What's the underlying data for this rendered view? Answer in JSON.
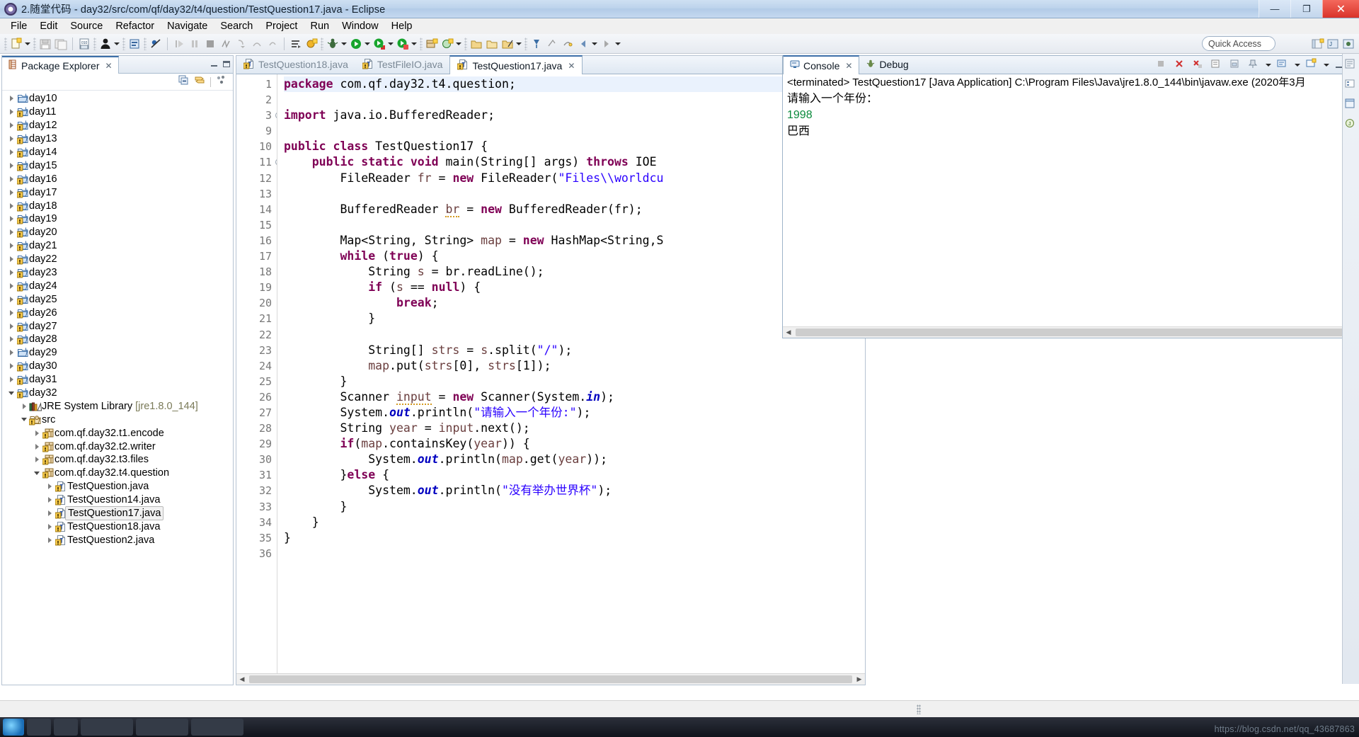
{
  "window": {
    "title": "2.随堂代码 - day32/src/com/qf/day32/t4/question/TestQuestion17.java - Eclipse",
    "minimize": "—",
    "maximize": "❐",
    "close": "✕"
  },
  "menubar": {
    "items": [
      "File",
      "Edit",
      "Source",
      "Refactor",
      "Navigate",
      "Search",
      "Project",
      "Run",
      "Window",
      "Help"
    ]
  },
  "toolbar": {
    "quick_access_placeholder": "Quick Access"
  },
  "package_explorer": {
    "tab_label": "Package Explorer",
    "close_label": "✕",
    "items": [
      {
        "label": "day10",
        "indent": 0,
        "icon": "folder-icon",
        "state": "closed",
        "warn": false
      },
      {
        "label": "day11",
        "indent": 0,
        "icon": "folder-icon",
        "state": "closed",
        "warn": true
      },
      {
        "label": "day12",
        "indent": 0,
        "icon": "folder-icon",
        "state": "closed",
        "warn": true
      },
      {
        "label": "day13",
        "indent": 0,
        "icon": "folder-icon",
        "state": "closed",
        "warn": true
      },
      {
        "label": "day14",
        "indent": 0,
        "icon": "folder-icon",
        "state": "closed",
        "warn": true
      },
      {
        "label": "day15",
        "indent": 0,
        "icon": "folder-icon",
        "state": "closed",
        "warn": true
      },
      {
        "label": "day16",
        "indent": 0,
        "icon": "folder-icon",
        "state": "closed",
        "warn": true
      },
      {
        "label": "day17",
        "indent": 0,
        "icon": "folder-icon",
        "state": "closed",
        "warn": true
      },
      {
        "label": "day18",
        "indent": 0,
        "icon": "folder-icon",
        "state": "closed",
        "warn": true
      },
      {
        "label": "day19",
        "indent": 0,
        "icon": "folder-icon",
        "state": "closed",
        "warn": true
      },
      {
        "label": "day20",
        "indent": 0,
        "icon": "folder-icon",
        "state": "closed",
        "warn": true
      },
      {
        "label": "day21",
        "indent": 0,
        "icon": "folder-icon",
        "state": "closed",
        "warn": true
      },
      {
        "label": "day22",
        "indent": 0,
        "icon": "folder-icon",
        "state": "closed",
        "warn": true
      },
      {
        "label": "day23",
        "indent": 0,
        "icon": "folder-icon",
        "state": "closed",
        "warn": true
      },
      {
        "label": "day24",
        "indent": 0,
        "icon": "folder-icon",
        "state": "closed",
        "warn": true
      },
      {
        "label": "day25",
        "indent": 0,
        "icon": "folder-icon",
        "state": "closed",
        "warn": true
      },
      {
        "label": "day26",
        "indent": 0,
        "icon": "folder-icon",
        "state": "closed",
        "warn": true
      },
      {
        "label": "day27",
        "indent": 0,
        "icon": "folder-icon",
        "state": "closed",
        "warn": true
      },
      {
        "label": "day28",
        "indent": 0,
        "icon": "folder-icon",
        "state": "closed",
        "warn": true
      },
      {
        "label": "day29",
        "indent": 0,
        "icon": "folder-icon",
        "state": "closed",
        "warn": false
      },
      {
        "label": "day30",
        "indent": 0,
        "icon": "folder-icon",
        "state": "closed",
        "warn": true
      },
      {
        "label": "day31",
        "indent": 0,
        "icon": "folder-icon",
        "state": "closed",
        "warn": true
      },
      {
        "label": "day32",
        "indent": 0,
        "icon": "folder-icon",
        "state": "open",
        "warn": true
      },
      {
        "label": "JRE System Library ",
        "suffix": "[jre1.8.0_144]",
        "indent": 1,
        "icon": "jre-library-icon",
        "state": "closed",
        "warn": false
      },
      {
        "label": "src",
        "indent": 1,
        "icon": "source-folder-icon",
        "state": "open",
        "warn": true
      },
      {
        "label": "com.qf.day32.t1.encode",
        "indent": 2,
        "icon": "package-icon",
        "state": "closed",
        "warn": true
      },
      {
        "label": "com.qf.day32.t2.writer",
        "indent": 2,
        "icon": "package-icon",
        "state": "closed",
        "warn": true
      },
      {
        "label": "com.qf.day32.t3.files",
        "indent": 2,
        "icon": "package-icon",
        "state": "closed",
        "warn": true
      },
      {
        "label": "com.qf.day32.t4.question",
        "indent": 2,
        "icon": "package-icon",
        "state": "open",
        "warn": true
      },
      {
        "label": "TestQuestion.java",
        "indent": 3,
        "icon": "java-file-icon",
        "state": "closed",
        "warn": true
      },
      {
        "label": "TestQuestion14.java",
        "indent": 3,
        "icon": "java-file-icon",
        "state": "closed",
        "warn": true
      },
      {
        "label": "TestQuestion17.java",
        "indent": 3,
        "icon": "java-file-icon",
        "state": "closed",
        "warn": true,
        "selected": true
      },
      {
        "label": "TestQuestion18.java",
        "indent": 3,
        "icon": "java-file-icon",
        "state": "closed",
        "warn": true
      },
      {
        "label": "TestQuestion2.java",
        "indent": 3,
        "icon": "java-file-icon",
        "state": "closed",
        "warn": true
      }
    ]
  },
  "editor": {
    "tabs": [
      {
        "label": "TestQuestion18.java",
        "active": false
      },
      {
        "label": "TestFileIO.java",
        "active": false
      },
      {
        "label": "TestQuestion17.java",
        "active": true,
        "close": "✕"
      }
    ],
    "line_numbers": [
      "1",
      "2",
      "3",
      "9",
      "10",
      "11",
      "12",
      "13",
      "14",
      "15",
      "16",
      "17",
      "18",
      "19",
      "20",
      "21",
      "22",
      "23",
      "24",
      "25",
      "26",
      "27",
      "28",
      "29",
      "30",
      "31",
      "32",
      "33",
      "34",
      "35",
      "36"
    ],
    "lines": [
      {
        "n": "1",
        "highlight": true,
        "fold": false,
        "annot": null,
        "tokens": [
          {
            "t": "package",
            "c": "kw"
          },
          {
            "t": " com.qf.day32.t4.question;",
            "c": ""
          }
        ]
      },
      {
        "n": "2",
        "highlight": false,
        "fold": false,
        "annot": null,
        "tokens": []
      },
      {
        "n": "3",
        "highlight": false,
        "fold": true,
        "annot": null,
        "tokens": [
          {
            "t": "import",
            "c": "kw"
          },
          {
            "t": " java.io.BufferedReader;",
            "c": ""
          }
        ]
      },
      {
        "n": "9",
        "highlight": false,
        "fold": false,
        "annot": null,
        "tokens": []
      },
      {
        "n": "10",
        "highlight": false,
        "fold": false,
        "annot": null,
        "tokens": [
          {
            "t": "public class",
            "c": "kw"
          },
          {
            "t": " TestQuestion17 {",
            "c": ""
          }
        ]
      },
      {
        "n": "11",
        "highlight": false,
        "fold": "minus",
        "annot": null,
        "tokens": [
          {
            "t": "    ",
            "c": ""
          },
          {
            "t": "public static void",
            "c": "kw"
          },
          {
            "t": " main(String[] args) ",
            "c": ""
          },
          {
            "t": "throws",
            "c": "kw"
          },
          {
            "t": " IOE",
            "c": ""
          }
        ]
      },
      {
        "n": "12",
        "highlight": false,
        "fold": false,
        "annot": null,
        "tokens": [
          {
            "t": "        FileReader ",
            "c": ""
          },
          {
            "t": "fr",
            "c": "loc"
          },
          {
            "t": " = ",
            "c": ""
          },
          {
            "t": "new",
            "c": "kw"
          },
          {
            "t": " FileReader(",
            "c": ""
          },
          {
            "t": "\"Files\\\\worldcu",
            "c": "str"
          }
        ]
      },
      {
        "n": "13",
        "highlight": false,
        "fold": false,
        "annot": null,
        "tokens": []
      },
      {
        "n": "14",
        "highlight": false,
        "fold": false,
        "annot": "warn",
        "tokens": [
          {
            "t": "        BufferedReader ",
            "c": ""
          },
          {
            "t": "br",
            "c": "loc und"
          },
          {
            "t": " = ",
            "c": ""
          },
          {
            "t": "new",
            "c": "kw"
          },
          {
            "t": " BufferedReader(fr);",
            "c": ""
          }
        ]
      },
      {
        "n": "15",
        "highlight": false,
        "fold": false,
        "annot": null,
        "tokens": []
      },
      {
        "n": "16",
        "highlight": false,
        "fold": false,
        "annot": null,
        "tokens": [
          {
            "t": "        Map<String, String> ",
            "c": ""
          },
          {
            "t": "map",
            "c": "loc"
          },
          {
            "t": " = ",
            "c": ""
          },
          {
            "t": "new",
            "c": "kw"
          },
          {
            "t": " HashMap<String,S",
            "c": ""
          }
        ]
      },
      {
        "n": "17",
        "highlight": false,
        "fold": false,
        "annot": null,
        "tokens": [
          {
            "t": "        ",
            "c": ""
          },
          {
            "t": "while",
            "c": "kw"
          },
          {
            "t": " (",
            "c": ""
          },
          {
            "t": "true",
            "c": "kw"
          },
          {
            "t": ") {",
            "c": ""
          }
        ]
      },
      {
        "n": "18",
        "highlight": false,
        "fold": false,
        "annot": null,
        "tokens": [
          {
            "t": "            String ",
            "c": ""
          },
          {
            "t": "s",
            "c": "loc"
          },
          {
            "t": " = br.readLine();",
            "c": ""
          }
        ]
      },
      {
        "n": "19",
        "highlight": false,
        "fold": false,
        "annot": null,
        "tokens": [
          {
            "t": "            ",
            "c": ""
          },
          {
            "t": "if",
            "c": "kw"
          },
          {
            "t": " (",
            "c": ""
          },
          {
            "t": "s",
            "c": "loc"
          },
          {
            "t": " == ",
            "c": ""
          },
          {
            "t": "null",
            "c": "kw"
          },
          {
            "t": ") {",
            "c": ""
          }
        ]
      },
      {
        "n": "20",
        "highlight": false,
        "fold": false,
        "annot": null,
        "tokens": [
          {
            "t": "                ",
            "c": ""
          },
          {
            "t": "break",
            "c": "kw"
          },
          {
            "t": ";",
            "c": ""
          }
        ]
      },
      {
        "n": "21",
        "highlight": false,
        "fold": false,
        "annot": null,
        "tokens": [
          {
            "t": "            }",
            "c": ""
          }
        ]
      },
      {
        "n": "22",
        "highlight": false,
        "fold": false,
        "annot": null,
        "tokens": []
      },
      {
        "n": "23",
        "highlight": false,
        "fold": false,
        "annot": null,
        "tokens": [
          {
            "t": "            String[] ",
            "c": ""
          },
          {
            "t": "strs",
            "c": "loc"
          },
          {
            "t": " = ",
            "c": ""
          },
          {
            "t": "s",
            "c": "loc"
          },
          {
            "t": ".split(",
            "c": ""
          },
          {
            "t": "\"/\"",
            "c": "str"
          },
          {
            "t": ");",
            "c": ""
          }
        ]
      },
      {
        "n": "24",
        "highlight": false,
        "fold": false,
        "annot": null,
        "tokens": [
          {
            "t": "            ",
            "c": ""
          },
          {
            "t": "map",
            "c": "loc"
          },
          {
            "t": ".put(",
            "c": ""
          },
          {
            "t": "strs",
            "c": "loc"
          },
          {
            "t": "[0], ",
            "c": ""
          },
          {
            "t": "strs",
            "c": "loc"
          },
          {
            "t": "[1]);",
            "c": ""
          }
        ]
      },
      {
        "n": "25",
        "highlight": false,
        "fold": false,
        "annot": null,
        "tokens": [
          {
            "t": "        }",
            "c": ""
          }
        ]
      },
      {
        "n": "26",
        "highlight": false,
        "fold": false,
        "annot": "warn",
        "tokens": [
          {
            "t": "        Scanner ",
            "c": ""
          },
          {
            "t": "input",
            "c": "loc und"
          },
          {
            "t": " = ",
            "c": ""
          },
          {
            "t": "new",
            "c": "kw"
          },
          {
            "t": " Scanner(System.",
            "c": ""
          },
          {
            "t": "in",
            "c": "fld"
          },
          {
            "t": ");",
            "c": ""
          }
        ]
      },
      {
        "n": "27",
        "highlight": false,
        "fold": false,
        "annot": null,
        "tokens": [
          {
            "t": "        System.",
            "c": ""
          },
          {
            "t": "out",
            "c": "fld"
          },
          {
            "t": ".println(",
            "c": ""
          },
          {
            "t": "\"请输入一个年份:\"",
            "c": "str"
          },
          {
            "t": ");",
            "c": ""
          }
        ]
      },
      {
        "n": "28",
        "highlight": false,
        "fold": false,
        "annot": null,
        "tokens": [
          {
            "t": "        String ",
            "c": ""
          },
          {
            "t": "year",
            "c": "loc"
          },
          {
            "t": " = ",
            "c": ""
          },
          {
            "t": "input",
            "c": "loc"
          },
          {
            "t": ".next();",
            "c": ""
          }
        ]
      },
      {
        "n": "29",
        "highlight": false,
        "fold": false,
        "annot": null,
        "tokens": [
          {
            "t": "        ",
            "c": ""
          },
          {
            "t": "if",
            "c": "kw"
          },
          {
            "t": "(",
            "c": ""
          },
          {
            "t": "map",
            "c": "loc"
          },
          {
            "t": ".containsKey(",
            "c": ""
          },
          {
            "t": "year",
            "c": "loc"
          },
          {
            "t": ")) {",
            "c": ""
          }
        ]
      },
      {
        "n": "30",
        "highlight": false,
        "fold": false,
        "annot": null,
        "tokens": [
          {
            "t": "            System.",
            "c": ""
          },
          {
            "t": "out",
            "c": "fld"
          },
          {
            "t": ".println(",
            "c": ""
          },
          {
            "t": "map",
            "c": "loc"
          },
          {
            "t": ".get(",
            "c": ""
          },
          {
            "t": "year",
            "c": "loc"
          },
          {
            "t": "));",
            "c": ""
          }
        ]
      },
      {
        "n": "31",
        "highlight": false,
        "fold": false,
        "annot": null,
        "tokens": [
          {
            "t": "        }",
            "c": ""
          },
          {
            "t": "else",
            "c": "kw"
          },
          {
            "t": " {",
            "c": ""
          }
        ]
      },
      {
        "n": "32",
        "highlight": false,
        "fold": false,
        "annot": null,
        "tokens": [
          {
            "t": "            System.",
            "c": ""
          },
          {
            "t": "out",
            "c": "fld"
          },
          {
            "t": ".println(",
            "c": ""
          },
          {
            "t": "\"没有举办世界杯\"",
            "c": "str"
          },
          {
            "t": ");",
            "c": ""
          }
        ]
      },
      {
        "n": "33",
        "highlight": false,
        "fold": false,
        "annot": null,
        "tokens": [
          {
            "t": "        }",
            "c": ""
          }
        ]
      },
      {
        "n": "34",
        "highlight": false,
        "fold": false,
        "annot": null,
        "tokens": [
          {
            "t": "    }",
            "c": ""
          }
        ]
      },
      {
        "n": "35",
        "highlight": false,
        "fold": false,
        "annot": null,
        "tokens": [
          {
            "t": "}",
            "c": ""
          }
        ]
      },
      {
        "n": "36",
        "highlight": false,
        "fold": false,
        "annot": null,
        "tokens": []
      }
    ]
  },
  "console": {
    "tabs": [
      {
        "label": "Console",
        "active": true,
        "close": "✕",
        "icon": "console-icon"
      },
      {
        "label": "Debug",
        "active": false,
        "icon": "debug-bug-icon"
      }
    ],
    "status_line": "<terminated> TestQuestion17 [Java Application] C:\\Program Files\\Java\\jre1.8.0_144\\bin\\javaw.exe (2020年3月",
    "output": [
      {
        "text": "请输入一个年份：",
        "kind": "normal"
      },
      {
        "text": "1998",
        "kind": "input"
      },
      {
        "text": "巴西",
        "kind": "normal"
      }
    ],
    "input_color": "#0a8a3c"
  },
  "statusbar": {
    "text": ""
  },
  "watermark": {
    "text": "https://blog.csdn.net/qq_43687863"
  }
}
